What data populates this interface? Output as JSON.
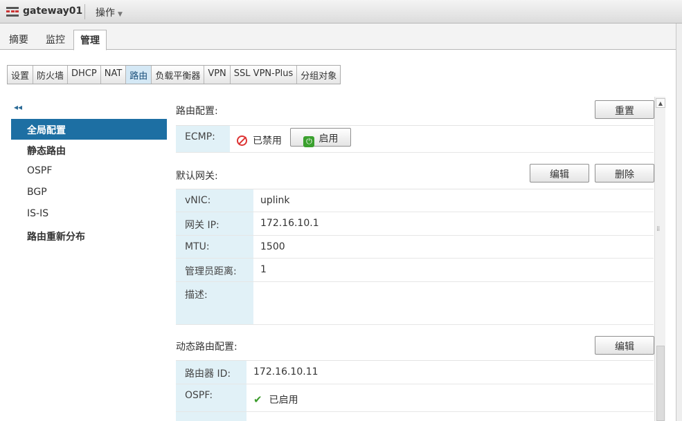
{
  "window": {
    "title": "gateway01",
    "actions_menu": "操作"
  },
  "main_tabs": [
    {
      "label": "摘要"
    },
    {
      "label": "监控"
    },
    {
      "label": "管理"
    }
  ],
  "sub_tabs": [
    {
      "label": "设置"
    },
    {
      "label": "防火墙"
    },
    {
      "label": "DHCP"
    },
    {
      "label": "NAT"
    },
    {
      "label": "路由"
    },
    {
      "label": "负载平衡器"
    },
    {
      "label": "VPN"
    },
    {
      "label": "SSL VPN-Plus"
    },
    {
      "label": "分组对象"
    }
  ],
  "left_nav": {
    "collapse": "◂◂",
    "items": [
      {
        "label": "全局配置"
      },
      {
        "label": "静态路由"
      },
      {
        "label": "OSPF"
      },
      {
        "label": "BGP"
      },
      {
        "label": "IS-IS"
      },
      {
        "label": "路由重新分布"
      }
    ]
  },
  "routing_config": {
    "title": "路由配置:",
    "reset_label": "重置",
    "ecmp_label": "ECMP:",
    "ecmp_status": "已禁用",
    "enable_label": "启用"
  },
  "default_gateway": {
    "title": "默认网关:",
    "edit_label": "编辑",
    "delete_label": "删除",
    "rows": [
      {
        "label": "vNIC:",
        "value": "uplink"
      },
      {
        "label": "网关 IP:",
        "value": "172.16.10.1"
      },
      {
        "label": "MTU:",
        "value": "1500"
      },
      {
        "label": "管理员距离:",
        "value": "1"
      },
      {
        "label": "描述:",
        "value": ""
      }
    ]
  },
  "dynamic_routing": {
    "title": "动态路由配置:",
    "edit_label": "编辑",
    "router_id_label": "路由器 ID:",
    "router_id_value": "172.16.10.11",
    "ospf_label": "OSPF:",
    "ospf_status": "已启用"
  },
  "colors": {
    "accent": "#1d6fa3",
    "label_bg": "#e1f1f7",
    "disabled": "#dd3333",
    "enabled": "#3a9b2a"
  }
}
